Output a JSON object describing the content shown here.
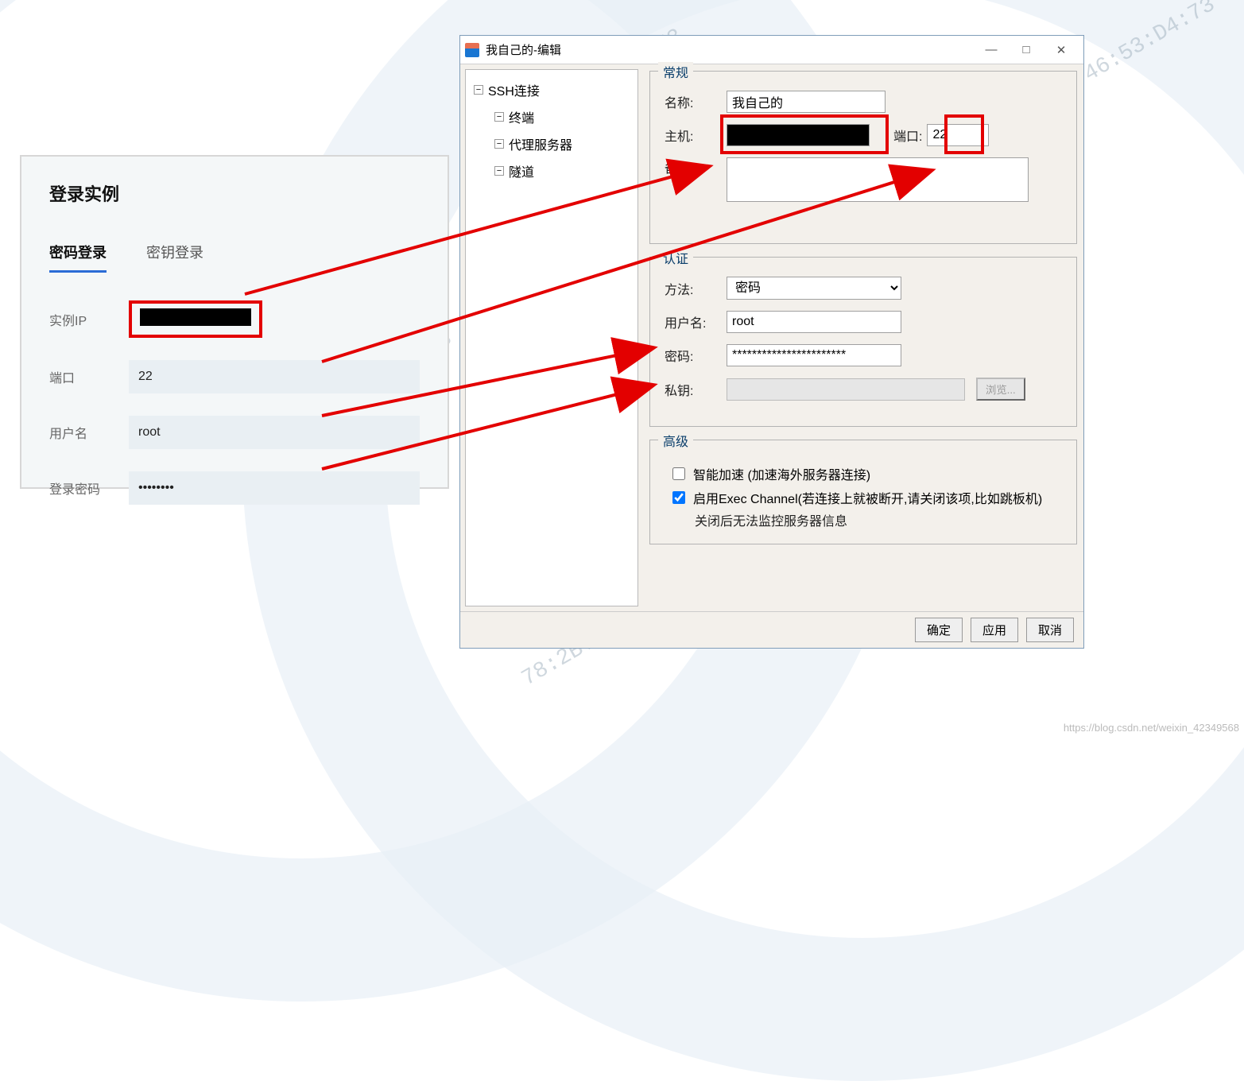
{
  "watermark_text": "78:2B:46:53:D4:73",
  "blog_url": "https://blog.csdn.net/weixin_42349568",
  "left_panel": {
    "title": "登录实例",
    "tabs": {
      "password": "密码登录",
      "key": "密钥登录"
    },
    "label_ip": "实例IP",
    "label_port": "端口",
    "label_user": "用户名",
    "label_pass": "登录密码",
    "port": "22",
    "user": "root",
    "pass": "••••••••"
  },
  "dialog": {
    "title": "我自己的-编辑",
    "tree": {
      "root": "SSH连接",
      "terminal": "终端",
      "proxy": "代理服务器",
      "tunnel": "隧道"
    },
    "general": {
      "legend": "常规",
      "label_name": "名称:",
      "name": "我自己的",
      "label_host": "主机:",
      "host_redacted": true,
      "label_port": "端口:",
      "port": "22",
      "label_note": "备注:",
      "note": ""
    },
    "auth": {
      "legend": "认证",
      "label_method": "方法:",
      "method": "密码",
      "label_user": "用户名:",
      "user": "root",
      "label_pass": "密码:",
      "pass": "***********************",
      "label_privkey": "私钥:",
      "browse": "浏览..."
    },
    "advanced": {
      "legend": "高级",
      "smart_accel": "智能加速 (加速海外服务器连接)",
      "exec_channel": "启用Exec Channel(若连接上就被断开,请关闭该项,比如跳板机)",
      "info": "关闭后无法监控服务器信息",
      "smart_checked": false,
      "exec_checked": true
    },
    "buttons": {
      "ok": "确定",
      "apply": "应用",
      "cancel": "取消"
    },
    "win": {
      "min": "—",
      "max": "□",
      "close": "✕"
    }
  }
}
